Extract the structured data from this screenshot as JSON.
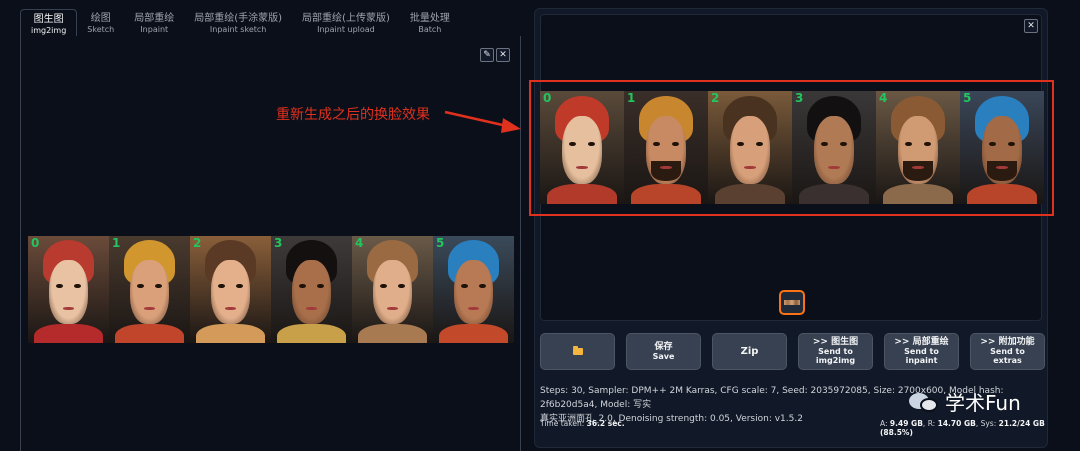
{
  "tabs": [
    {
      "label": "图生图",
      "sub": "img2img"
    },
    {
      "label": "绘图",
      "sub": "Sketch"
    },
    {
      "label": "局部重绘",
      "sub": "Inpaint"
    },
    {
      "label": "局部重绘(手涂蒙版)",
      "sub": "Inpaint sketch"
    },
    {
      "label": "局部重绘(上传蒙版)",
      "sub": "Inpaint upload"
    },
    {
      "label": "批量处理",
      "sub": "Batch"
    }
  ],
  "left_panel": {
    "edit_icon": "pencil-icon",
    "close_icon": "close-icon",
    "faces": [
      {
        "num": "0",
        "skin": "#e8c2a2",
        "hair": "#1a1410",
        "bg": "#6b4b3a",
        "cloth": "#b52a2a",
        "headwear": "#b93a2e"
      },
      {
        "num": "1",
        "skin": "#d9a07a",
        "hair": "#6b3a22",
        "bg": "#4a3a2e",
        "cloth": "#c0452a",
        "headwear": "#d1962e"
      },
      {
        "num": "2",
        "skin": "#e4b08c",
        "hair": "#5a3a24",
        "bg": "#8a5f3a",
        "cloth": "#d49a5a",
        "headwear": ""
      },
      {
        "num": "3",
        "skin": "#a86f4a",
        "hair": "#141010",
        "bg": "#3e3a3a",
        "cloth": "#c9a04a",
        "headwear": ""
      },
      {
        "num": "4",
        "skin": "#e0ae8a",
        "hair": "#9a6a42",
        "bg": "#6a5a48",
        "cloth": "#a87a52",
        "headwear": ""
      },
      {
        "num": "5",
        "skin": "#b87a54",
        "hair": "#120c0a",
        "bg": "#3a4a5a",
        "cloth": "#c24a2a",
        "headwear": "#2a7fbf"
      }
    ]
  },
  "right_panel": {
    "close_icon": "close-icon",
    "annotation": "重新生成之后的换脸效果",
    "faces": [
      {
        "num": "0",
        "skin": "#e6c09e",
        "hair": "#141010",
        "bg": "#5a4a3a",
        "cloth": "#b23a2a",
        "headwear": "#c03a2a",
        "beard": false
      },
      {
        "num": "1",
        "skin": "#c88a62",
        "hair": "#3a2418",
        "bg": "#3a2e28",
        "cloth": "#b8452a",
        "headwear": "#c8872e",
        "beard": true
      },
      {
        "num": "2",
        "skin": "#d8a07a",
        "hair": "#4a3220",
        "bg": "#7a5a3a",
        "cloth": "#5a4030",
        "headwear": "",
        "beard": false
      },
      {
        "num": "3",
        "skin": "#b07a54",
        "hair": "#121010",
        "bg": "#3a3838",
        "cloth": "#3a3030",
        "headwear": "",
        "beard": false
      },
      {
        "num": "4",
        "skin": "#d09a72",
        "hair": "#8a5a34",
        "bg": "#6a5844",
        "cloth": "#8a6a4a",
        "headwear": "",
        "beard": true
      },
      {
        "num": "5",
        "skin": "#a26a46",
        "hair": "#140e0a",
        "bg": "#3a4658",
        "cloth": "#b8452a",
        "headwear": "#2a7fbf",
        "beard": true
      }
    ]
  },
  "buttons": {
    "folder": {
      "icon": "folder-icon"
    },
    "save": {
      "label": "保存",
      "sub": "Save"
    },
    "zip": {
      "label": "Zip"
    },
    "send_img2img": {
      "label": ">> 图生图",
      "sub": "Send to img2img"
    },
    "send_inpaint": {
      "label": ">> 局部重绘",
      "sub": "Send to inpaint"
    },
    "send_extras": {
      "label": ">> 附加功能",
      "sub": "Send to extras"
    }
  },
  "info": {
    "line1": "Steps: 30, Sampler: DPM++ 2M Karras, CFG scale: 7, Seed: 2035972085, Size: 2700x600, Model hash: 2f6b20d5a4, Model: 写实",
    "line2": "真实亚洲面孔_2.0, Denoising strength: 0.05, Version: v1.5.2",
    "time_label": "Time taken:",
    "time_value": "36.2 sec.",
    "mem_a_label": "A:",
    "mem_a": "9.49 GB",
    "mem_r_label": "R:",
    "mem_r": "14.70 GB",
    "mem_sys_label": "Sys:",
    "mem_sys": "21.2/24 GB (88.5%)"
  },
  "watermark": {
    "text": "学术Fun",
    "icon": "wechat-icon"
  }
}
